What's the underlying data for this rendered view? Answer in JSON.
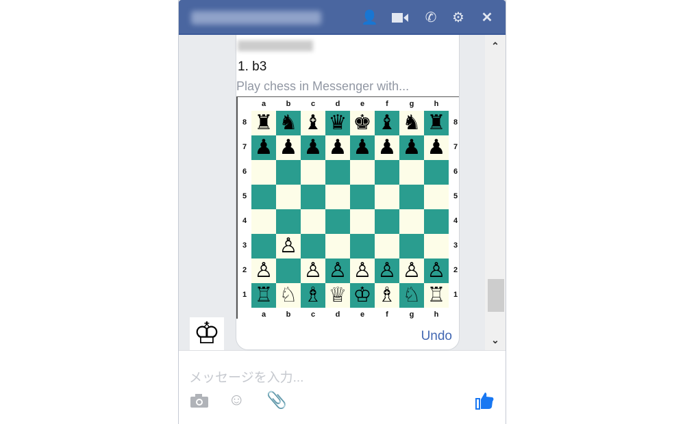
{
  "header": {
    "icons": [
      "add-person-icon",
      "video-icon",
      "phone-icon",
      "gear-icon",
      "close-icon"
    ]
  },
  "message": {
    "move": "1. b3",
    "description": "Play chess in Messenger with...",
    "undo_label": "Undo"
  },
  "board": {
    "files": [
      "a",
      "b",
      "c",
      "d",
      "e",
      "f",
      "g",
      "h"
    ],
    "ranks": [
      "8",
      "7",
      "6",
      "5",
      "4",
      "3",
      "2",
      "1"
    ],
    "rows": [
      [
        "♜",
        "♞",
        "♝",
        "♛",
        "♚",
        "♝",
        "♞",
        "♜"
      ],
      [
        "♟",
        "♟",
        "♟",
        "♟",
        "♟",
        "♟",
        "♟",
        "♟"
      ],
      [
        "",
        "",
        "",
        "",
        "",
        "",
        "",
        ""
      ],
      [
        "",
        "",
        "",
        "",
        "",
        "",
        "",
        ""
      ],
      [
        "",
        "",
        "",
        "",
        "",
        "",
        "",
        ""
      ],
      [
        "",
        "♙",
        "",
        "",
        "",
        "",
        "",
        ""
      ],
      [
        "♙",
        "",
        "♙",
        "♙",
        "♙",
        "♙",
        "♙",
        "♙"
      ],
      [
        "♖",
        "♘",
        "♗",
        "♕",
        "♔",
        "♗",
        "♘",
        "♖"
      ]
    ],
    "light": "#fdfde8",
    "dark": "#2a9d8f"
  },
  "avatar": {
    "glyph": "♔"
  },
  "composer": {
    "placeholder": "メッセージを入力...",
    "icons": [
      "camera-icon",
      "emoji-icon",
      "attachment-icon",
      "like-icon"
    ]
  },
  "colors": {
    "header": "#4a66a0",
    "accent": "#4267b2"
  }
}
